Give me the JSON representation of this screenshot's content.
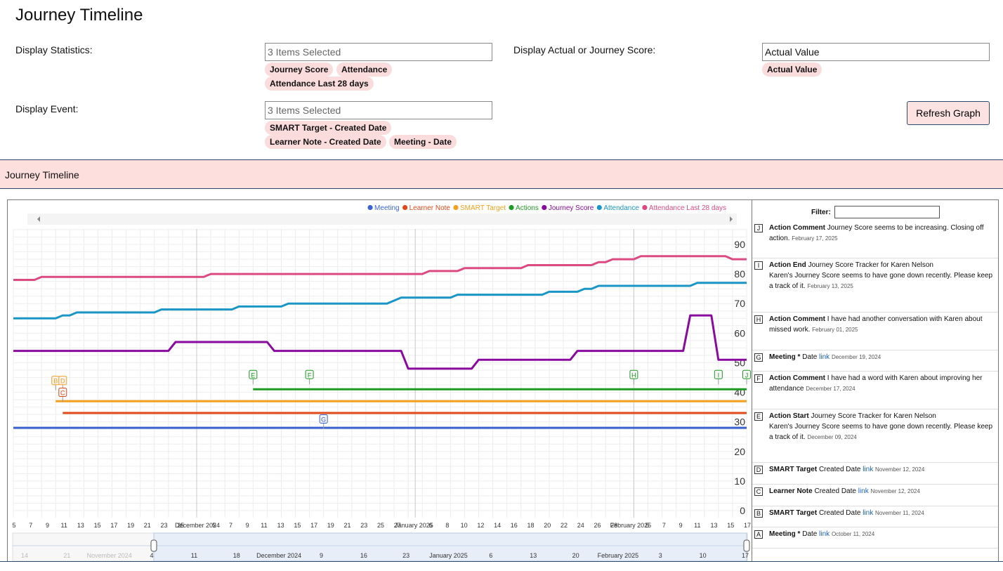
{
  "page_title": "Journey Timeline",
  "controls": {
    "stats_label": "Display Statistics:",
    "stats_placeholder": "3 Items Selected",
    "stats_chips": [
      "Journey Score",
      "Attendance",
      "Attendance Last 28 days"
    ],
    "actual_label": "Display Actual or Journey Score:",
    "actual_value": "Actual Value",
    "actual_chips": [
      "Actual Value"
    ],
    "event_label": "Display Event:",
    "event_placeholder": "3 Items Selected",
    "event_chips": [
      "SMART Target - Created Date",
      "Learner Note - Created Date",
      "Meeting - Date"
    ],
    "refresh_label": "Refresh Graph"
  },
  "section_title": "Journey Timeline",
  "filter_label": "Filter:",
  "chart_data": {
    "type": "line",
    "legend": [
      {
        "name": "Meeting",
        "color": "#3a63d1"
      },
      {
        "name": "Learner Note",
        "color": "#e04a1a"
      },
      {
        "name": "SMART Target",
        "color": "#f3a01c"
      },
      {
        "name": "Actions",
        "color": "#1f9a23"
      },
      {
        "name": "Journey Score",
        "color": "#8a0aa0"
      },
      {
        "name": "Attendance",
        "color": "#1a96c6"
      },
      {
        "name": "Attendance Last 28 days",
        "color": "#dc4a82"
      }
    ],
    "y_ticks": [
      "90",
      "80",
      "70",
      "60",
      "50",
      "40",
      "30",
      "20",
      "10",
      "0"
    ],
    "ylim": [
      0,
      90
    ],
    "xlim": [
      "2024-11-05",
      "2025-02-17"
    ],
    "x_tick_labels": [
      "5",
      "7",
      "9",
      "11",
      "13",
      "15",
      "17",
      "19",
      "21",
      "23",
      "25",
      "December 2024",
      "5",
      "7",
      "9",
      "11",
      "13",
      "15",
      "17",
      "19",
      "21",
      "23",
      "25",
      "27",
      "January 2025",
      "6",
      "8",
      "10",
      "12",
      "14",
      "16",
      "18",
      "20",
      "22",
      "24",
      "26",
      "28",
      "February 2025",
      "5",
      "7",
      "9",
      "11",
      "13",
      "15",
      "17"
    ],
    "navigator_labels": [
      "14",
      "21",
      "November 2024",
      "4",
      "11",
      "18",
      "December 2024",
      "9",
      "16",
      "23",
      "January 2025",
      "6",
      "13",
      "20",
      "February 2025",
      "3",
      "10",
      "17"
    ],
    "series": [
      {
        "name": "Attendance Last 28 days",
        "color": "#dc4a82",
        "points": [
          [
            "2024-11-05",
            78
          ],
          [
            "2024-11-08",
            78
          ],
          [
            "2024-11-09",
            79
          ],
          [
            "2024-12-02",
            79
          ],
          [
            "2024-12-03",
            80
          ],
          [
            "2025-01-02",
            80
          ],
          [
            "2025-01-03",
            81
          ],
          [
            "2025-01-07",
            81
          ],
          [
            "2025-01-08",
            82
          ],
          [
            "2025-01-16",
            82
          ],
          [
            "2025-01-17",
            83
          ],
          [
            "2025-01-26",
            83
          ],
          [
            "2025-01-27",
            84
          ],
          [
            "2025-01-28",
            84
          ],
          [
            "2025-01-29",
            85
          ],
          [
            "2025-02-01",
            85
          ],
          [
            "2025-02-02",
            86
          ],
          [
            "2025-02-14",
            86
          ],
          [
            "2025-02-15",
            85
          ],
          [
            "2025-02-17",
            85
          ]
        ]
      },
      {
        "name": "Attendance",
        "color": "#1a96c6",
        "points": [
          [
            "2024-11-05",
            65
          ],
          [
            "2024-11-11",
            65
          ],
          [
            "2024-11-12",
            66
          ],
          [
            "2024-11-13",
            66
          ],
          [
            "2024-11-14",
            67
          ],
          [
            "2024-11-25",
            67
          ],
          [
            "2024-11-26",
            68
          ],
          [
            "2024-12-06",
            68
          ],
          [
            "2024-12-07",
            69
          ],
          [
            "2024-12-13",
            69
          ],
          [
            "2024-12-14",
            70
          ],
          [
            "2024-12-28",
            70
          ],
          [
            "2024-12-30",
            72
          ],
          [
            "2025-01-06",
            72
          ],
          [
            "2025-01-07",
            73
          ],
          [
            "2025-01-13",
            73
          ],
          [
            "2025-01-19",
            73
          ],
          [
            "2025-01-20",
            74
          ],
          [
            "2025-01-24",
            74
          ],
          [
            "2025-01-25",
            75
          ],
          [
            "2025-01-26",
            75
          ],
          [
            "2025-01-27",
            76
          ],
          [
            "2025-02-09",
            76
          ],
          [
            "2025-02-10",
            77
          ],
          [
            "2025-02-17",
            77
          ]
        ]
      },
      {
        "name": "Journey Score",
        "color": "#8a0aa0",
        "points": [
          [
            "2024-11-05",
            54
          ],
          [
            "2024-11-27",
            54
          ],
          [
            "2024-11-28",
            57
          ],
          [
            "2024-12-11",
            57
          ],
          [
            "2024-12-12",
            54
          ],
          [
            "2024-12-30",
            54
          ],
          [
            "2024-12-31",
            48
          ],
          [
            "2025-01-09",
            48
          ],
          [
            "2025-01-10",
            51
          ],
          [
            "2025-01-23",
            51
          ],
          [
            "2025-01-24",
            54
          ],
          [
            "2025-02-08",
            54
          ],
          [
            "2025-02-09",
            66
          ],
          [
            "2025-02-12",
            66
          ],
          [
            "2025-02-13",
            51
          ],
          [
            "2025-02-17",
            51
          ]
        ]
      },
      {
        "name": "Actions",
        "color": "#1f9a23",
        "points": [
          [
            "2024-12-09",
            41
          ],
          [
            "2025-02-17",
            41
          ]
        ]
      },
      {
        "name": "SMART Target",
        "color": "#f3a01c",
        "points": [
          [
            "2024-11-11",
            37
          ],
          [
            "2025-02-17",
            37
          ]
        ]
      },
      {
        "name": "Learner Note",
        "color": "#e04a1a",
        "points": [
          [
            "2024-11-12",
            33
          ],
          [
            "2025-02-17",
            33
          ]
        ]
      },
      {
        "name": "Meeting",
        "color": "#3a63d1",
        "points": [
          [
            "2024-11-05",
            28
          ],
          [
            "2025-02-17",
            28
          ]
        ]
      }
    ],
    "flags": [
      {
        "key": "B",
        "date": "2024-11-11",
        "y": 44,
        "color": "#f3a01c"
      },
      {
        "key": "D",
        "date": "2024-11-12",
        "y": 44,
        "color": "#f3a01c"
      },
      {
        "key": "C",
        "date": "2024-11-12",
        "y": 40,
        "color": "#e04a1a"
      },
      {
        "key": "E",
        "date": "2024-12-09",
        "y": 46,
        "color": "#1f9a23"
      },
      {
        "key": "F",
        "date": "2024-12-17",
        "y": 46,
        "color": "#1f9a23"
      },
      {
        "key": "G",
        "date": "2024-12-19",
        "y": 31,
        "color": "#3a63d1"
      },
      {
        "key": "H",
        "date": "2025-02-01",
        "y": 46,
        "color": "#1f9a23"
      },
      {
        "key": "I",
        "date": "2025-02-13",
        "y": 46,
        "color": "#1f9a23"
      },
      {
        "key": "J",
        "date": "2025-02-17",
        "y": 46,
        "color": "#1f9a23"
      }
    ]
  },
  "events": [
    {
      "key": "J",
      "type": "Action Comment",
      "text": "Journey Score seems to be increasing. Closing off action.",
      "date": "February 17, 2025"
    },
    {
      "key": "I",
      "type": "Action End",
      "text": "Journey Score Tracker for Karen Nelson",
      "text2": "Karen's Journey Score seems to have gone down recently. Please keep a track of it.",
      "date": "February 13, 2025"
    },
    {
      "key": "H",
      "type": "Action Comment",
      "text": "I have had another conversation with Karen about missed work.",
      "date": "February 01, 2025"
    },
    {
      "key": "G",
      "type": "Meeting *",
      "text": "Date",
      "link": "link",
      "date": "December 19, 2024"
    },
    {
      "key": "F",
      "type": "Action Comment",
      "text": "I have had a word with Karen about improving her attendance",
      "date": "December 17, 2024"
    },
    {
      "key": "E",
      "type": "Action Start",
      "text": "Journey Score Tracker for Karen Nelson",
      "text2": "Karen's Journey Score seems to have gone down recently. Please keep a track of it.",
      "date": "December 09, 2024"
    },
    {
      "key": "D",
      "type": "SMART Target",
      "text": "Created Date",
      "link": "link",
      "date": "November 12, 2024"
    },
    {
      "key": "C",
      "type": "Learner Note",
      "text": "Created Date",
      "link": "link",
      "date": "November 12, 2024"
    },
    {
      "key": "B",
      "type": "SMART Target",
      "text": "Created Date",
      "link": "link",
      "date": "November 11, 2024"
    },
    {
      "key": "A",
      "type": "Meeting *",
      "text": "Date",
      "link": "link",
      "date": "October 11, 2024"
    }
  ]
}
